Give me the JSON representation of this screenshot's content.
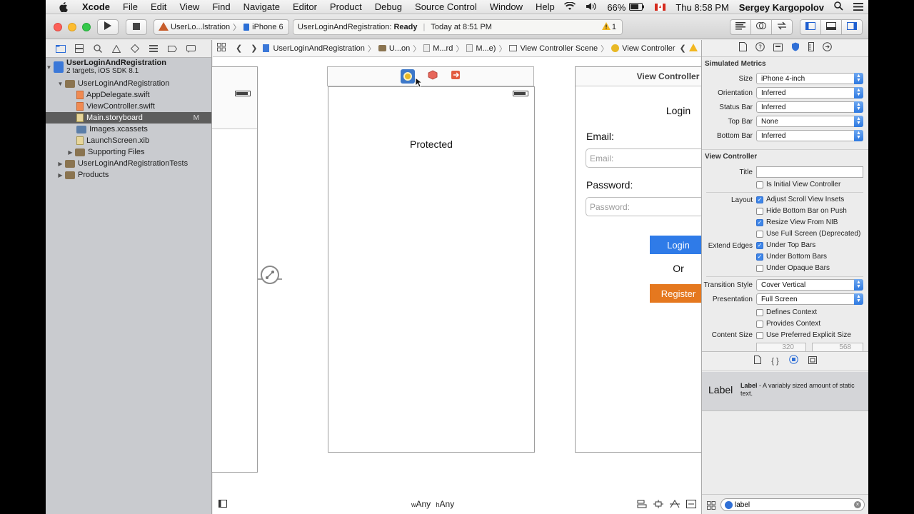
{
  "menubar": {
    "app": "Xcode",
    "items": [
      "File",
      "Edit",
      "View",
      "Find",
      "Navigate",
      "Editor",
      "Product",
      "Debug",
      "Source Control",
      "Window",
      "Help"
    ],
    "battery": "66%",
    "clock": "Thu 8:58 PM",
    "user": "Sergey Kargopolov"
  },
  "toolbar": {
    "scheme": "UserLo...lstration",
    "device": "iPhone 6",
    "status_project": "UserLoginAndRegistration:",
    "status_state": "Ready",
    "status_time": "Today at 8:51 PM",
    "warning_count": "1"
  },
  "navigator": {
    "project_name": "UserLoginAndRegistration",
    "project_sub": "2 targets, iOS SDK 8.1",
    "group": "UserLoginAndRegistration",
    "files": [
      "AppDelegate.swift",
      "ViewController.swift",
      "Main.storyboard",
      "Images.xcassets",
      "LaunchScreen.xib",
      "Supporting Files"
    ],
    "modified_badge": "M",
    "tests": "UserLoginAndRegistrationTests",
    "products": "Products"
  },
  "jumpbar": [
    "UserLoginAndRegistration",
    "U...on",
    "M...rd",
    "M...e)",
    "View Controller Scene",
    "View Controller"
  ],
  "canvas": {
    "protected_label": "Protected",
    "vc_title": "View Controller",
    "login_title": "Login",
    "email_label": "Email:",
    "email_placeholder": "Email:",
    "password_label": "Password:",
    "password_placeholder": "Password:",
    "login_button": "Login",
    "or_label": "Or",
    "register_button": "Register",
    "size_class_w": "w",
    "size_class_w_val": "Any",
    "size_class_h": "h",
    "size_class_h_val": "Any"
  },
  "inspector": {
    "sim_header": "Simulated Metrics",
    "size_label": "Size",
    "size_value": "iPhone 4-inch",
    "orientation_label": "Orientation",
    "orientation_value": "Inferred",
    "status_bar_label": "Status Bar",
    "status_bar_value": "Inferred",
    "top_bar_label": "Top Bar",
    "top_bar_value": "None",
    "bottom_bar_label": "Bottom Bar",
    "bottom_bar_value": "Inferred",
    "vc_header": "View Controller",
    "title_label": "Title",
    "title_value": "",
    "initial_vc": "Is Initial View Controller",
    "layout_label": "Layout",
    "adjust_scroll": "Adjust Scroll View Insets",
    "hide_bottom": "Hide Bottom Bar on Push",
    "resize_nib": "Resize View From NIB",
    "full_screen": "Use Full Screen (Deprecated)",
    "extend_label": "Extend Edges",
    "under_top": "Under Top Bars",
    "under_bottom": "Under Bottom Bars",
    "under_opaque": "Under Opaque Bars",
    "transition_label": "Transition Style",
    "transition_value": "Cover Vertical",
    "presentation_label": "Presentation",
    "presentation_value": "Full Screen",
    "defines_context": "Defines Context",
    "provides_context": "Provides Context",
    "content_size_label": "Content Size",
    "preferred_size": "Use Preferred Explicit Size",
    "width_value": "320",
    "height_value": "568",
    "library_item_title": "Label",
    "library_item_name": "Label",
    "library_item_desc": "- A variably sized amount of static text.",
    "filter_value": "label"
  },
  "colors": {
    "login_button": "#2f7be8",
    "register_button": "#e5781f",
    "selection": "#5d5d5d"
  }
}
